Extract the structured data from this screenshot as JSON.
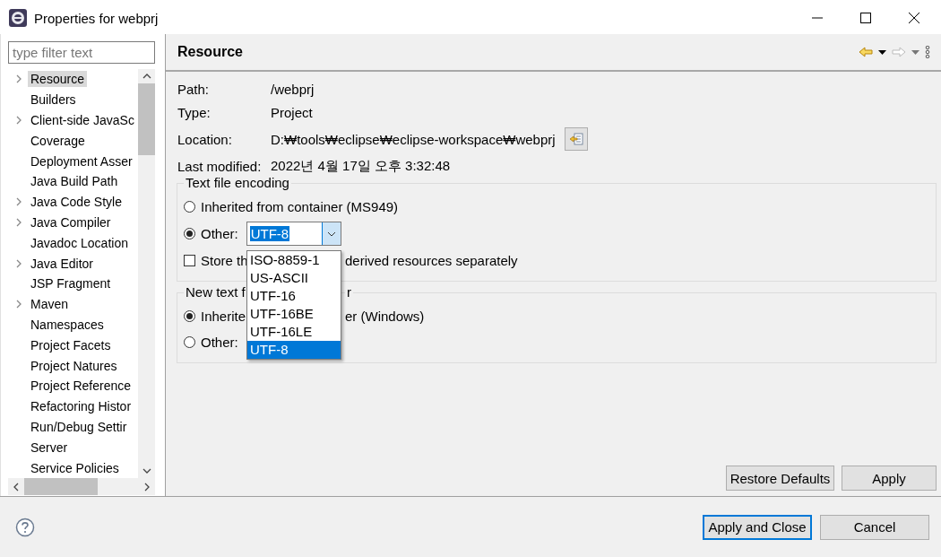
{
  "window": {
    "title": "Properties for webprj"
  },
  "filter": {
    "placeholder": "type filter text"
  },
  "tree": [
    {
      "label": "Resource",
      "expandable": true,
      "selected": true
    },
    {
      "label": "Builders",
      "expandable": false,
      "selected": false
    },
    {
      "label": "Client-side JavaSc",
      "expandable": true,
      "selected": false
    },
    {
      "label": "Coverage",
      "expandable": false,
      "selected": false
    },
    {
      "label": "Deployment Asser",
      "expandable": false,
      "selected": false
    },
    {
      "label": "Java Build Path",
      "expandable": false,
      "selected": false
    },
    {
      "label": "Java Code Style",
      "expandable": true,
      "selected": false
    },
    {
      "label": "Java Compiler",
      "expandable": true,
      "selected": false
    },
    {
      "label": "Javadoc Location",
      "expandable": false,
      "selected": false
    },
    {
      "label": "Java Editor",
      "expandable": true,
      "selected": false
    },
    {
      "label": "JSP Fragment",
      "expandable": false,
      "selected": false
    },
    {
      "label": "Maven",
      "expandable": true,
      "selected": false
    },
    {
      "label": "Namespaces",
      "expandable": false,
      "selected": false
    },
    {
      "label": "Project Facets",
      "expandable": false,
      "selected": false
    },
    {
      "label": "Project Natures",
      "expandable": false,
      "selected": false
    },
    {
      "label": "Project Reference",
      "expandable": false,
      "selected": false
    },
    {
      "label": "Refactoring Histor",
      "expandable": false,
      "selected": false
    },
    {
      "label": "Run/Debug Settir",
      "expandable": false,
      "selected": false
    },
    {
      "label": "Server",
      "expandable": false,
      "selected": false
    },
    {
      "label": "Service Policies",
      "expandable": false,
      "selected": false
    }
  ],
  "page_title": "Resource",
  "properties": [
    {
      "label": "Path:",
      "value": "/webprj"
    },
    {
      "label": "Type:",
      "value": "Project"
    },
    {
      "label": "Location:",
      "value": "D:₩tools₩eclipse₩eclipse-workspace₩webprj",
      "has_button": true
    },
    {
      "label": "Last modified:",
      "value": "2022년 4월 17일 오후 3:32:48"
    }
  ],
  "encoding": {
    "title": "Text file encoding",
    "inherited": {
      "label": "Inherited from container (MS949)",
      "selected": false
    },
    "other": {
      "label": "Other:",
      "selected": true,
      "value": "UTF-8"
    },
    "store": {
      "label_parts": [
        "Store th",
        "derived resources separately"
      ],
      "checked": false
    }
  },
  "delimiter": {
    "title_parts": [
      "New text f",
      "r"
    ],
    "inherited": {
      "label_parts": [
        "Inherite",
        "er (Windows)"
      ],
      "selected": true
    },
    "other": {
      "label": "Other:",
      "selected": false
    }
  },
  "dropdown_options": [
    {
      "label": "ISO-8859-1",
      "selected": false
    },
    {
      "label": "US-ASCII",
      "selected": false
    },
    {
      "label": "UTF-16",
      "selected": false
    },
    {
      "label": "UTF-16BE",
      "selected": false
    },
    {
      "label": "UTF-16LE",
      "selected": false
    },
    {
      "label": "UTF-8",
      "selected": true
    }
  ],
  "page_buttons": [
    "Restore Defaults",
    "Apply"
  ],
  "dialog_buttons": [
    {
      "label": "Apply and Close",
      "default": true
    },
    {
      "label": "Cancel",
      "default": false
    }
  ]
}
